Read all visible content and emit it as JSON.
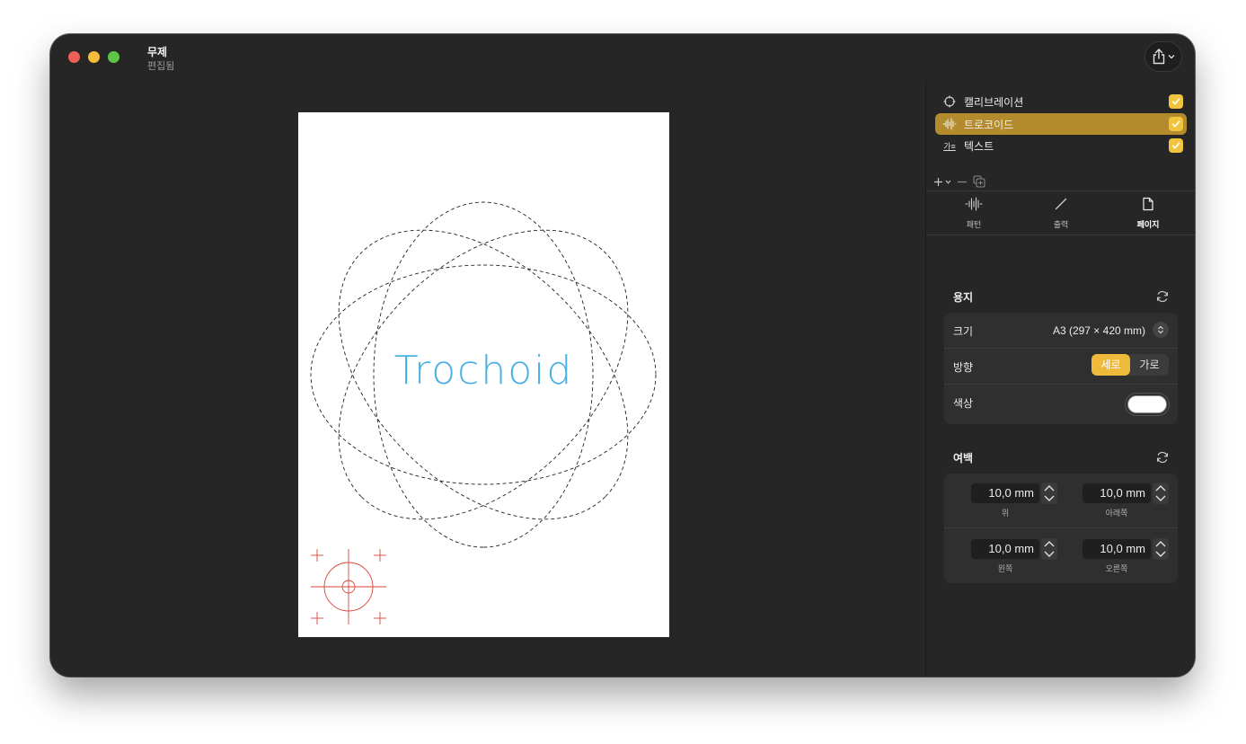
{
  "window": {
    "title": "무제",
    "subtitle": "편집됨"
  },
  "canvas": {
    "paper_text": "Trochoid",
    "text_color": "#4ab0e4",
    "pattern_color": "#222222",
    "calibration_color": "#d9463a"
  },
  "layers": [
    {
      "name": "캘리브레이션",
      "icon": "crosshair-icon",
      "checked": true,
      "selected": false
    },
    {
      "name": "트로코이드",
      "icon": "waveform-icon",
      "checked": true,
      "selected": true
    },
    {
      "name": "텍스트",
      "icon": "text-icon",
      "icon_text": "가≡",
      "checked": true,
      "selected": false
    }
  ],
  "tabs": [
    {
      "label": "패턴",
      "icon": "waveform-icon"
    },
    {
      "label": "출력",
      "icon": "pen-icon"
    },
    {
      "label": "페이지",
      "icon": "document-icon",
      "active": true
    }
  ],
  "paper_section": {
    "title": "용지",
    "size_label": "크기",
    "size_value": "A3 (297 × 420 mm)",
    "orientation_label": "방향",
    "orientation_options": [
      "세로",
      "가로"
    ],
    "orientation_selected": "세로",
    "color_label": "색상",
    "color_value": "#ffffff"
  },
  "margin_section": {
    "title": "여백",
    "top": {
      "value": "10,0 mm",
      "label": "위"
    },
    "bottom": {
      "value": "10,0 mm",
      "label": "아래쪽"
    },
    "left": {
      "value": "10,0 mm",
      "label": "왼쪽"
    },
    "right": {
      "value": "10,0 mm",
      "label": "오른쪽"
    }
  },
  "colors": {
    "accent": "#efb93a",
    "selected_layer": "#b38b2d",
    "window_bg": "#262626"
  }
}
